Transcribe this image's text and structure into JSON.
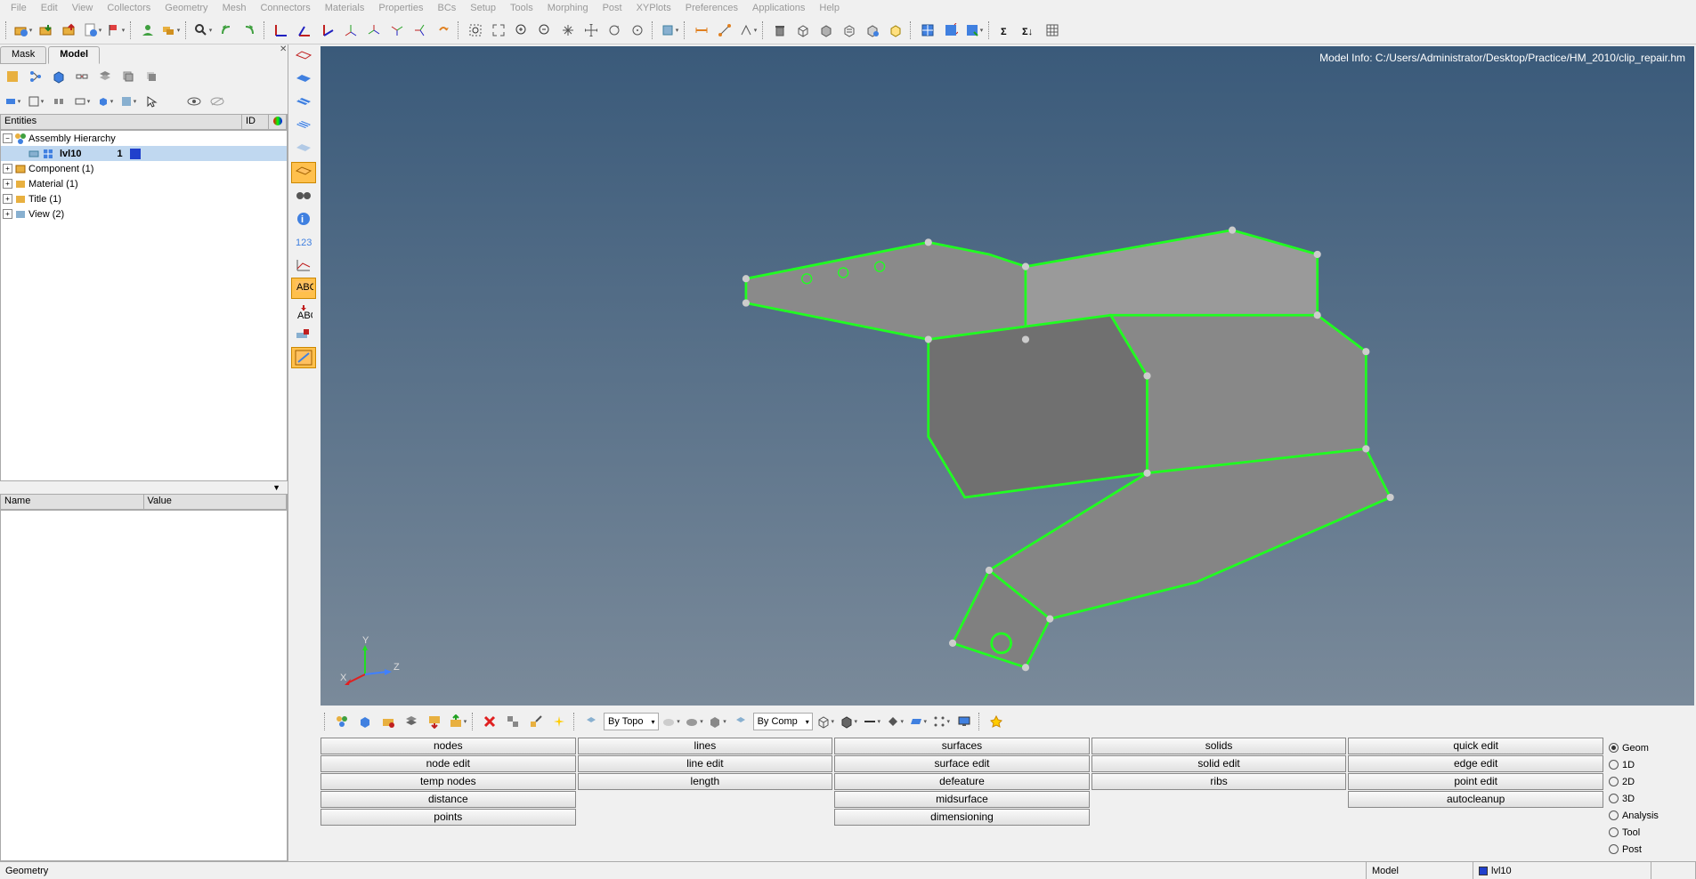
{
  "menu": [
    "File",
    "Edit",
    "View",
    "Collectors",
    "Geometry",
    "Mesh",
    "Connectors",
    "Materials",
    "Properties",
    "BCs",
    "Setup",
    "Tools",
    "Morphing",
    "Post",
    "XYPlots",
    "Preferences",
    "Applications",
    "Help"
  ],
  "tabs": {
    "mask": "Mask",
    "model": "Model"
  },
  "tree": {
    "header_entities": "Entities",
    "header_id": "ID",
    "root": "Assembly Hierarchy",
    "item1_name": "lvl10",
    "item1_id": "1",
    "comp": "Component (1)",
    "mat": "Material (1)",
    "title": "Title (1)",
    "view": "View (2)"
  },
  "props": {
    "name": "Name",
    "value": "Value"
  },
  "viewport": {
    "model_info": "Model Info: C:/Users/Administrator/Desktop/Practice/HM_2010/clip_repair.hm",
    "axis_x": "X",
    "axis_y": "Y",
    "axis_z": "Z"
  },
  "bottom_combo": {
    "bytopo": "By Topo",
    "bycomp": "By Comp"
  },
  "panels": {
    "col1": [
      "nodes",
      "node edit",
      "temp nodes",
      "distance",
      "points"
    ],
    "col2": [
      "lines",
      "line edit",
      "length",
      "",
      ""
    ],
    "col3": [
      "surfaces",
      "surface edit",
      "defeature",
      "midsurface",
      "dimensioning"
    ],
    "col4": [
      "solids",
      "solid edit",
      "ribs",
      "",
      ""
    ],
    "col5": [
      "quick edit",
      "edge edit",
      "point edit",
      "autocleanup",
      ""
    ]
  },
  "radios": [
    "Geom",
    "1D",
    "2D",
    "3D",
    "Analysis",
    "Tool",
    "Post"
  ],
  "status": {
    "left": "Geometry",
    "model_label": "Model",
    "comp_name": "lvl10"
  }
}
